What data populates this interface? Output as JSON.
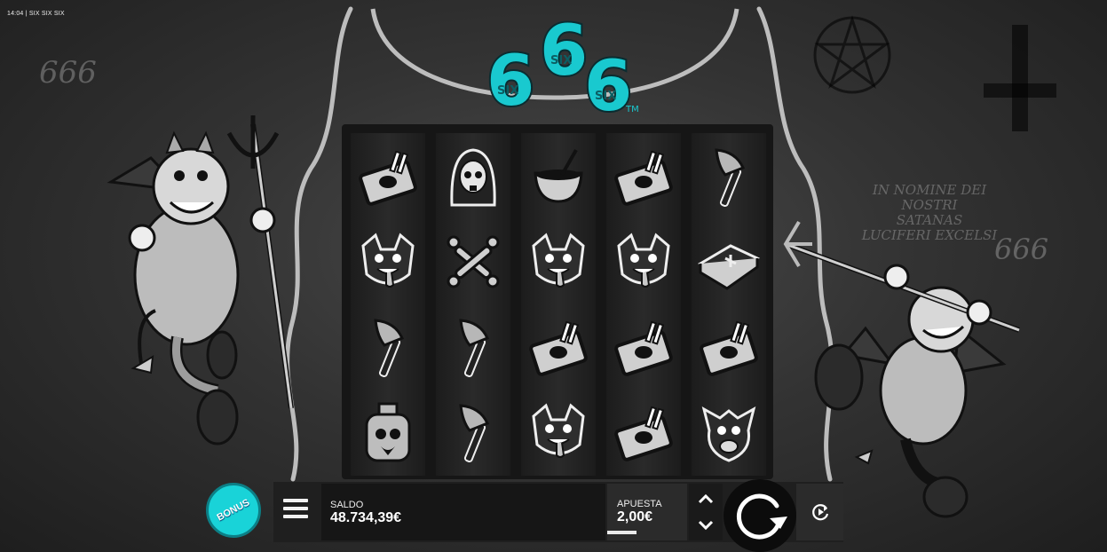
{
  "status": {
    "time_game": "14:04 | SIX SIX SIX"
  },
  "background_text": {
    "left_666": "666",
    "right_666": "666",
    "latin_line1": "IN NOMINE DEI NOSTRI",
    "latin_line2": "SATANAS",
    "latin_line3": "LUCIFERI EXCELSI"
  },
  "logo": {
    "word": "SIX",
    "digit": "6",
    "trademark": "TM",
    "color": "#19c9cf"
  },
  "reels": [
    [
      "matches",
      "cat",
      "axe",
      "potion"
    ],
    [
      "reaper",
      "bones",
      "axe",
      "axe"
    ],
    [
      "cauldron",
      "cat",
      "matches",
      "cat"
    ],
    [
      "matches",
      "cat",
      "matches",
      "matches"
    ],
    [
      "axe",
      "book",
      "matches",
      "goat"
    ]
  ],
  "controls": {
    "bonus_label": "BONUS",
    "balance_label": "SALDO",
    "balance_value": "48.734,39€",
    "bet_label": "APUESTA",
    "bet_value": "2,00€",
    "accent": "#19d3d8"
  }
}
